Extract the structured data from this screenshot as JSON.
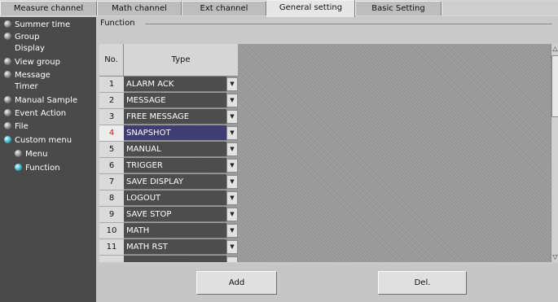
{
  "tabs": [
    {
      "label": "Measure channel",
      "active": false
    },
    {
      "label": "Math channel",
      "active": false
    },
    {
      "label": "Ext channel",
      "active": false
    },
    {
      "label": "General setting",
      "active": true
    },
    {
      "label": "Basic Setting",
      "active": false
    }
  ],
  "sidebar": {
    "items": [
      {
        "label": "Summer time"
      },
      {
        "label": "Group"
      },
      {
        "label": "Display"
      },
      {
        "label": "View group"
      },
      {
        "label": "Message"
      },
      {
        "label": "Timer"
      },
      {
        "label": "Manual Sample"
      },
      {
        "label": "Event Action"
      },
      {
        "label": "File"
      },
      {
        "label": "Custom menu",
        "selected": true
      },
      {
        "label": "Menu"
      },
      {
        "label": "Function",
        "selected": true
      }
    ]
  },
  "section": {
    "label": "Function"
  },
  "table": {
    "header_no": "No.",
    "header_type": "Type",
    "selected_no": "4",
    "rows": [
      {
        "no": "1",
        "type": "ALARM ACK"
      },
      {
        "no": "2",
        "type": "MESSAGE"
      },
      {
        "no": "3",
        "type": "FREE MESSAGE"
      },
      {
        "no": "4",
        "type": "SNAPSHOT"
      },
      {
        "no": "5",
        "type": "MANUAL"
      },
      {
        "no": "6",
        "type": "TRIGGER"
      },
      {
        "no": "7",
        "type": "SAVE DISPLAY"
      },
      {
        "no": "8",
        "type": "LOGOUT"
      },
      {
        "no": "9",
        "type": "SAVE STOP"
      },
      {
        "no": "10",
        "type": "MATH"
      },
      {
        "no": "11",
        "type": "MATH RST"
      }
    ]
  },
  "buttons": {
    "add": "Add",
    "del": "Del."
  },
  "icons": {
    "dropdown": "chevron-down-icon",
    "scroll_up": "triangle-up-icon",
    "scroll_down": "triangle-down-icon",
    "bullet": "radio-bullet-icon"
  },
  "colors": {
    "selected_row": "#3f3d72",
    "selected_no": "#d11a1a",
    "nav_bg": "#4a4a4a",
    "selected_bullet": "#4fc3d6"
  }
}
